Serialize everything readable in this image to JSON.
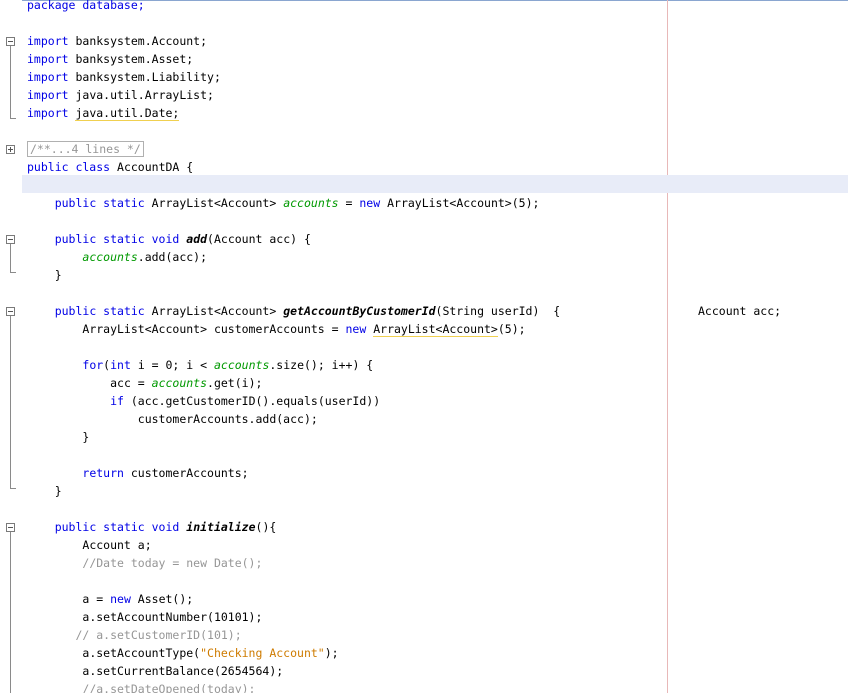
{
  "code": {
    "package": "package database;",
    "imports": [
      "banksystem.Account;",
      "banksystem.Asset;",
      "banksystem.Liability;",
      "java.util.ArrayList;",
      "java.util.Date;"
    ],
    "collapsed_comment": "/**...4 lines */",
    "class_name": "AccountDA",
    "field_decl": "accounts",
    "field_init": "ArrayList<Account>(5);",
    "add_method": "add",
    "add_params": "(Account acc) {",
    "add_body": ".add(acc);",
    "getby_method": "getAccountByCustomerId",
    "getby_params": "(String userId)  {",
    "getby_trailing": "Account acc;",
    "customer_accounts_decl": "ArrayList<Account> customerAccounts = ",
    "customer_accounts_init": "ArrayList<Account>",
    "customer_accounts_tail": "(5);",
    "for_head_a": "(",
    "for_head_b": " i = 0; i < ",
    "for_head_c": ".size(); i++) {",
    "acc_assign": "acc = ",
    "acc_get": ".get(i);",
    "if_cond": " (acc.getCustomerID().equals(userId))",
    "add_to_list": "customerAccounts.add(acc);",
    "return_expr": " customerAccounts;",
    "init_method": "initialize",
    "init_params": "(){",
    "account_a": "Account a;",
    "date_comment": "//Date today = new Date();",
    "a_new": "a = ",
    "asset_ctor": " Asset();",
    "set_number": "a.setAccountNumber(10101);",
    "set_customer_comment": "// a.setCustomerID(101);",
    "set_type_a": "a.setAccountType(",
    "set_type_str": "\"Checking Account\"",
    "set_type_b": ");",
    "set_balance": "a.setCurrentBalance(2654564);",
    "set_date_comment": "//a.setDateOpened(today);"
  },
  "colors": {
    "keyword": "#0000e6",
    "field": "#009900",
    "string": "#ce7b00",
    "comment": "#969696",
    "current_line": "#e8ecf8"
  }
}
